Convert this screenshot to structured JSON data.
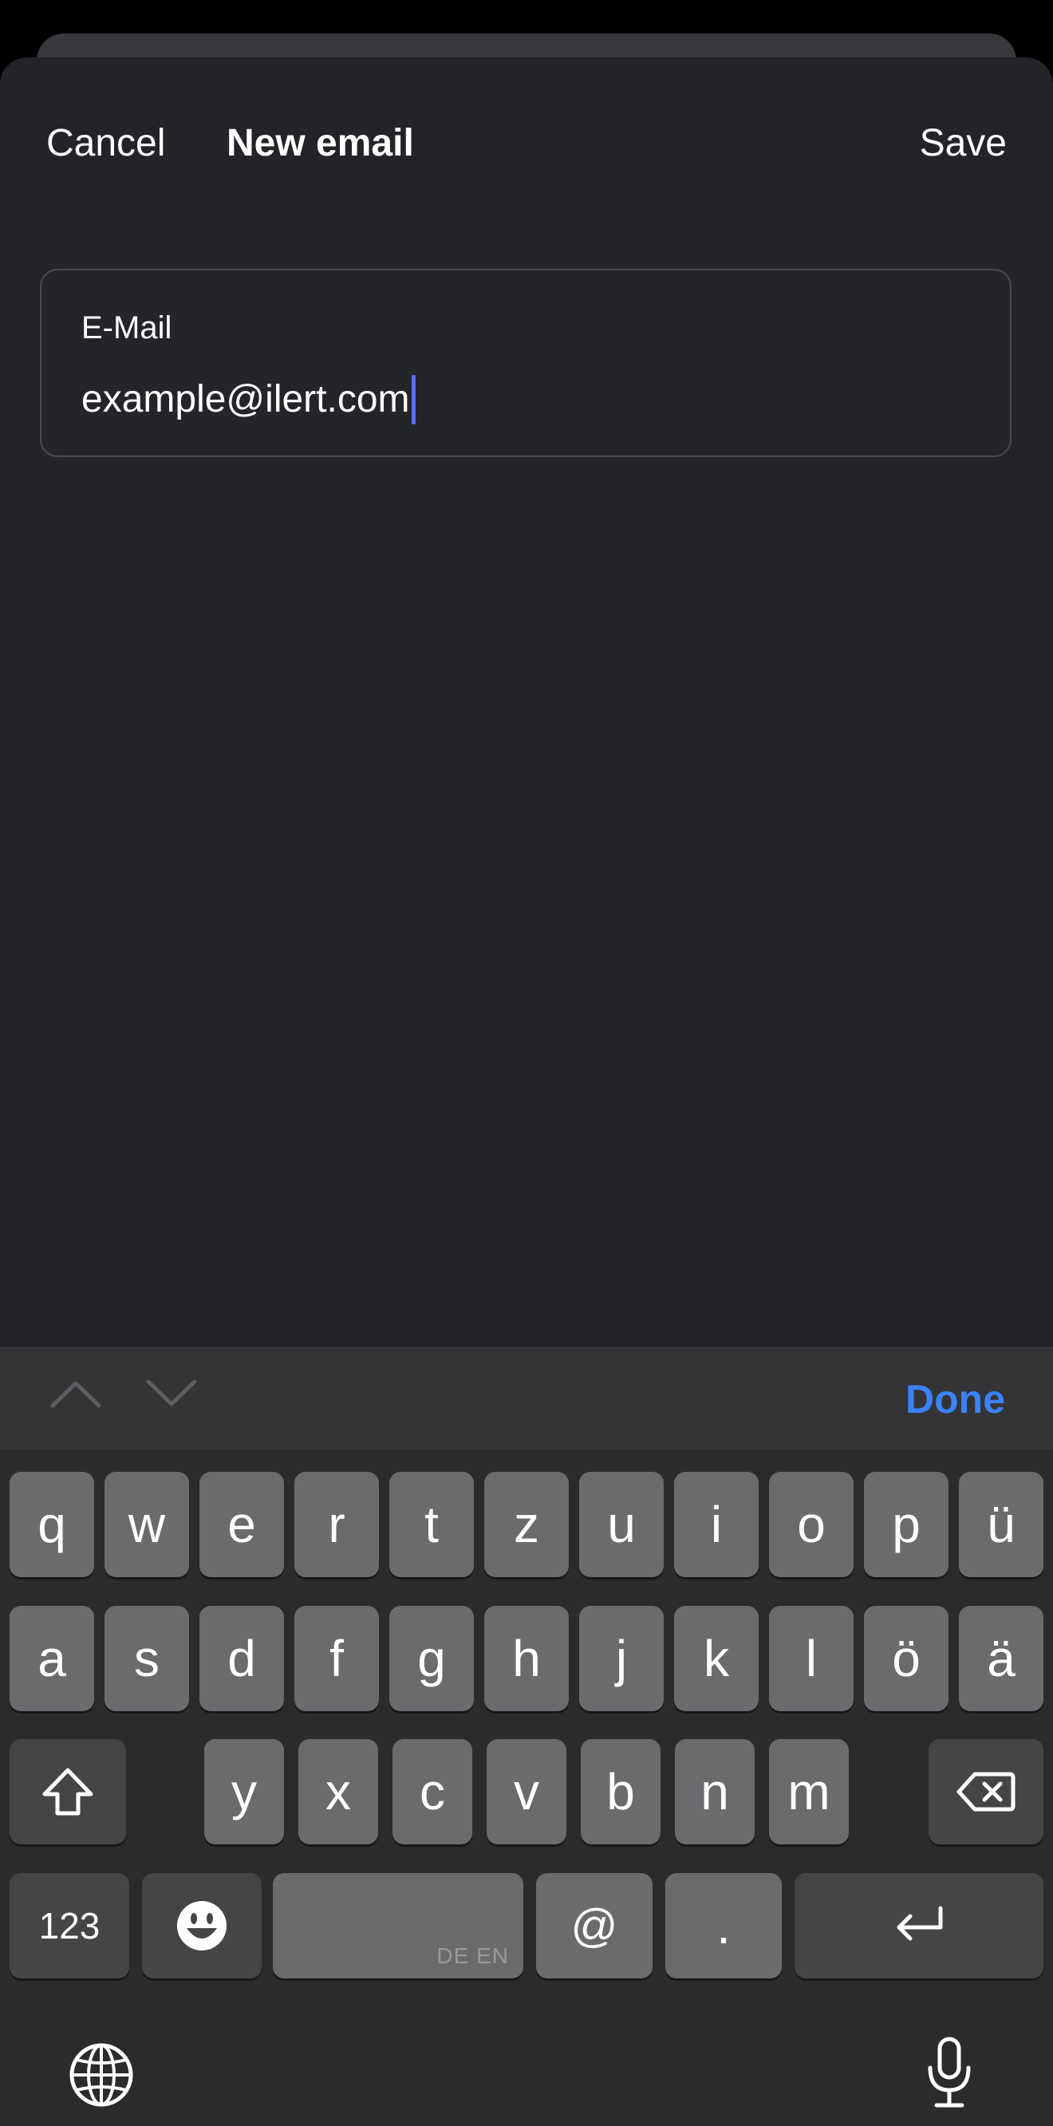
{
  "nav": {
    "cancel": "Cancel",
    "title": "New email",
    "save": "Save"
  },
  "email_field": {
    "label": "E-Mail",
    "value": "example@ilert.com"
  },
  "accessory": {
    "prev_icon": "chevron-up-icon",
    "next_icon": "chevron-down-icon",
    "done": "Done"
  },
  "keyboard": {
    "row1": [
      "q",
      "w",
      "e",
      "r",
      "t",
      "z",
      "u",
      "i",
      "o",
      "p",
      "ü"
    ],
    "row2": [
      "a",
      "s",
      "d",
      "f",
      "g",
      "h",
      "j",
      "k",
      "l",
      "ö",
      "ä"
    ],
    "row3": [
      "y",
      "x",
      "c",
      "v",
      "b",
      "n",
      "m"
    ],
    "numbers": "123",
    "space_lang": "DE EN",
    "at": "@",
    "dot": ".",
    "shift_icon": "shift-icon",
    "delete_icon": "delete-icon",
    "emoji_icon": "emoji-icon",
    "return_icon": "return-icon",
    "globe_icon": "globe-icon",
    "mic_icon": "microphone-icon"
  },
  "colors": {
    "accent": "#3b82f6",
    "caret": "#5b6cf0",
    "sheet_bg": "#232428",
    "key_bg": "#6b6b6e",
    "key_dark_bg": "#454547"
  }
}
